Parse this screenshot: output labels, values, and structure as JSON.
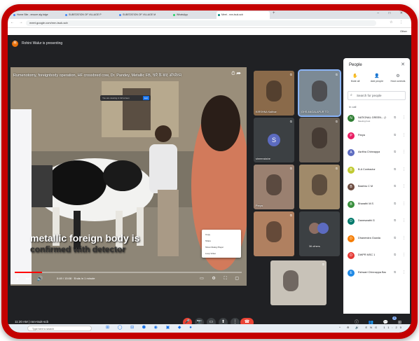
{
  "browser": {
    "tabs": [
      {
        "label": "Home Site - ensure alg bdge",
        "active": false
      },
      {
        "label": "SUBSTATION OF VILLAGE P",
        "active": false
      },
      {
        "label": "SUBSTATION OF VILLAGE M",
        "active": false
      },
      {
        "label": "WhatsApp",
        "active": false
      },
      {
        "label": "Meet - nnn-tsuk-scb",
        "active": true
      }
    ],
    "new_tab": "+",
    "window_controls": "– □ ✕",
    "url": "meet.google.com/nnn-tsuk-scb",
    "nav": "← → ⟳",
    "menu_icons": "☆ ⋮",
    "bookmark_right": "Other"
  },
  "meet": {
    "presenter": {
      "initial": "R",
      "text": "Rohini Walur is presenting"
    },
    "video": {
      "title": "Rumenotomy, foreignbody operation, HF crossbred cow, Dr. Pandey, Metallic FB, चारे के बाद ऑपरेशन",
      "title_icons": "⏱ ➦",
      "notice": "You are viewing in full screen",
      "notice_button": "Exit",
      "caption_line1": "metallic foreign body is",
      "caption_line2": "confirmed with detector",
      "time": "0:49 / 15:08 · Ends in 1 minute",
      "progress": 0.12,
      "controls_left": "⏸ ⏭ 🔊",
      "controls_right": "▭ ⚙ ⛶ ▢",
      "context_menu": [
        "Copy",
        "Share",
        "Show Dialog Player",
        "Loop Video"
      ]
    },
    "tiles": [
      {
        "name": "KIRSHNA Kaithar",
        "kind": "video",
        "bg": "#8a6a4a"
      },
      {
        "name": "GHS ANGALAPUR TO",
        "kind": "video",
        "bg": "#7c8a95",
        "active": true
      },
      {
        "name": "shreerakshe",
        "kind": "avatar",
        "initial": "S",
        "color": "#5c6bc0"
      },
      {
        "name": "",
        "kind": "video",
        "bg": "#6a6055"
      },
      {
        "name": "Parya",
        "kind": "video",
        "bg": "#9a8070"
      },
      {
        "name": "",
        "kind": "video",
        "bg": "#a08a6a"
      },
      {
        "name": "",
        "kind": "video",
        "bg": "#b08060"
      },
      {
        "name": "36 others",
        "kind": "others"
      },
      {
        "name": "",
        "kind": "video",
        "bg": "#c8c2b8"
      }
    ],
    "people": {
      "title": "People",
      "close": "✕",
      "actions": [
        {
          "icon": "✋",
          "label": "Mute all"
        },
        {
          "icon": "👤",
          "label": "Add people"
        },
        {
          "icon": "⚙",
          "label": "Host controls"
        }
      ],
      "search_placeholder": "Search for people",
      "in_call": "In call",
      "list": [
        {
          "name": "NATIONAL GREEN... (You)",
          "sub": "Meeting host",
          "color": "#2e7d32",
          "initial": "N"
        },
        {
          "name": "Parya",
          "sub": "",
          "color": "#e91e63",
          "initial": "P"
        },
        {
          "name": "Asritha Chinnappa",
          "sub": "",
          "color": "#5c6bc0",
          "initial": "A"
        },
        {
          "name": "B.A Contractor",
          "sub": "",
          "color": "#c0ca33",
          "initial": "B"
        },
        {
          "name": "Basthru C M",
          "sub": "",
          "color": "#6d4c41",
          "initial": "B"
        },
        {
          "name": "Bharathi M.S",
          "sub": "",
          "color": "#388e3c",
          "initial": "B"
        },
        {
          "name": "Daneswathi G",
          "sub": "",
          "color": "#00796b",
          "initial": "D"
        },
        {
          "name": "Dhanendra Gowda",
          "sub": "",
          "color": "#f57c00",
          "initial": "D"
        },
        {
          "name": "DWPR MSC 1",
          "sub": "",
          "color": "#e53935",
          "initial": "D"
        },
        {
          "name": "Eshwari Chinnappa Baddine",
          "sub": "",
          "color": "#1e88e5",
          "initial": "E"
        }
      ]
    },
    "bottom_bar": {
      "meeting_info": "11:20 AM  |  nnn-tsuk-scb",
      "buttons": [
        "🎤",
        "📷",
        "▭",
        "⬆",
        "⋮"
      ],
      "end_call": "☎",
      "right_icons": "ⓘ 👥 💬 ⊞",
      "people_count": "4"
    }
  },
  "taskbar": {
    "search_placeholder": "Type here to search",
    "icons": "⊞ ◯ ⊟ ⬢ ◉ ▣ ◆ ●",
    "tray": "^ ⟰ 🔊 ENG 11:20"
  }
}
